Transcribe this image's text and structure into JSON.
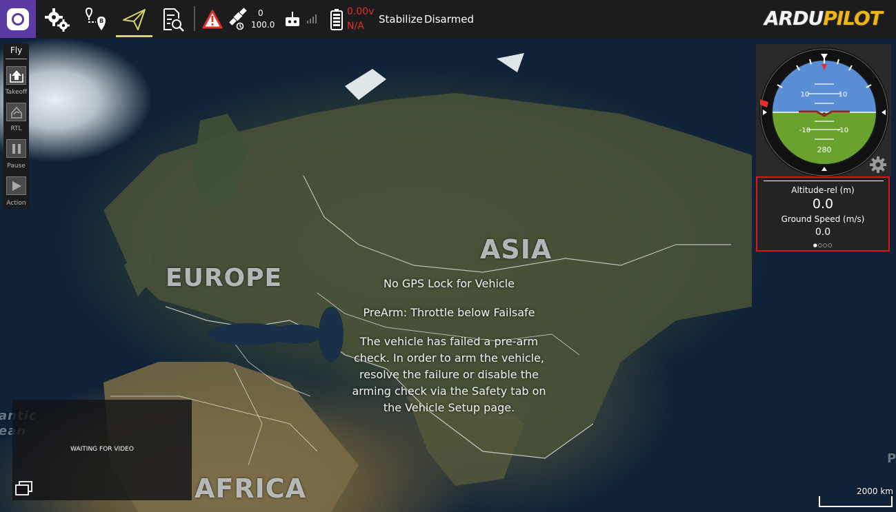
{
  "toolbar": {
    "gps_count": "0",
    "gps_hdop": "100.0",
    "battery_voltage": "0.00v",
    "battery_remaining": "N/A",
    "flight_mode": "Stabilize",
    "arm_state": "Disarmed",
    "brand_a": "ARDU",
    "brand_b": "PILOT"
  },
  "fly_panel": {
    "title": "Fly",
    "takeoff": "Takeoff",
    "rtl": "RTL",
    "pause": "Pause",
    "action": "Action"
  },
  "map": {
    "europe": "EUROPE",
    "asia": "ASIA",
    "africa": "AFRICA",
    "scale": "2000 km",
    "atlantic_a": "antic",
    "atlantic_b": "ean",
    "edge_p": "P"
  },
  "attitude": {
    "pitch_plus": "10",
    "pitch_minus": "-10",
    "heading": "280"
  },
  "values": {
    "alt_label": "Altitude-rel (m)",
    "alt_value": "0.0",
    "speed_label": "Ground Speed (m/s)",
    "speed_value": "0.0",
    "page_dots": "●○○○"
  },
  "messages": {
    "gps": "No GPS Lock for Vehicle",
    "prearm": "PreArm: Throttle below Failsafe",
    "body": "The vehicle has failed a pre-arm check. In order to arm the vehicle, resolve the failure or disable the arming check via the Safety tab on the Vehicle Setup page."
  },
  "video": {
    "status": "WAITING FOR VIDEO"
  },
  "colors": {
    "toolbar_bg": "#1c1c1e",
    "logo_bg": "#5b3aa3",
    "active_accent": "#d9d46b",
    "warning_red": "#e0302a",
    "highlight_border": "#e01515",
    "sky": "#5a8fd6",
    "ground": "#6aa22e"
  }
}
